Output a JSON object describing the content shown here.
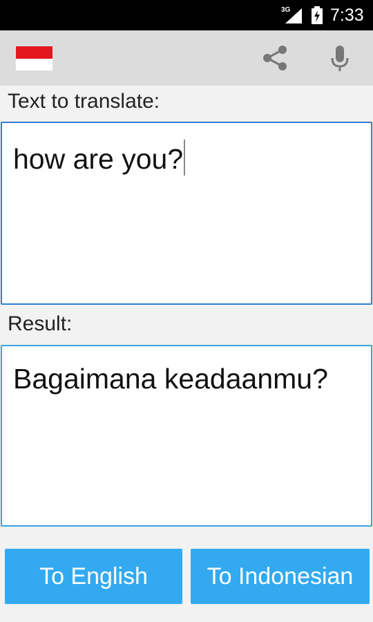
{
  "status_bar": {
    "network": "3G",
    "time": "7:33"
  },
  "app_bar": {
    "flag_colors": [
      "#e3161e",
      "#ffffff"
    ],
    "share_icon": "share-icon",
    "mic_icon": "microphone-icon"
  },
  "input": {
    "label": "Text to translate:",
    "value": "how are you?"
  },
  "result": {
    "label": "Result:",
    "value": "Bagaimana keadaanmu?"
  },
  "buttons": {
    "to_english": "To English",
    "to_indonesian": "To Indonesian"
  },
  "colors": {
    "accent": "#33aaf0",
    "input_border": "#2f7fd0",
    "result_border": "#36a4e0"
  }
}
